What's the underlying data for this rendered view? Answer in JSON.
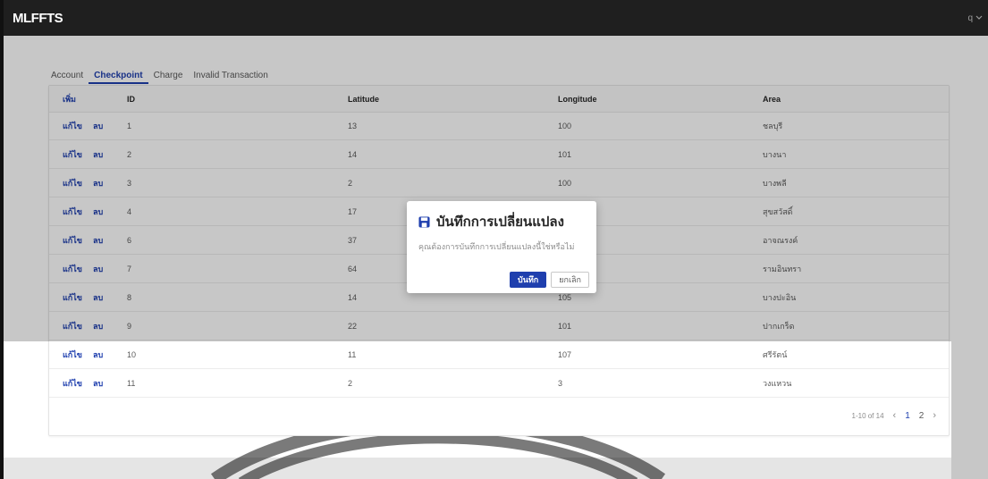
{
  "header": {
    "logo": "MLFFTS",
    "user_menu": "q"
  },
  "tabs": [
    {
      "label": "Account"
    },
    {
      "label": "Checkpoint",
      "active": true
    },
    {
      "label": "Charge"
    },
    {
      "label": "Invalid Transaction"
    }
  ],
  "table": {
    "add_label": "เพิ่ม",
    "columns": [
      "ID",
      "Latitude",
      "Longitude",
      "Area"
    ],
    "edit_label": "แก้ไข",
    "delete_label": "ลบ",
    "rows": [
      {
        "id": "1",
        "lat": "13",
        "lng": "100",
        "area": "ชลบุรี"
      },
      {
        "id": "2",
        "lat": "14",
        "lng": "101",
        "area": "บางนา"
      },
      {
        "id": "3",
        "lat": "2",
        "lng": "100",
        "area": "บางพลี"
      },
      {
        "id": "4",
        "lat": "17",
        "lng": "",
        "area": "สุขสวัสดิ์"
      },
      {
        "id": "6",
        "lat": "37",
        "lng": "",
        "area": "อาจณรงค์"
      },
      {
        "id": "7",
        "lat": "64",
        "lng": "",
        "area": "รามอินทรา"
      },
      {
        "id": "8",
        "lat": "14",
        "lng": "105",
        "area": "บางปะอิน"
      },
      {
        "id": "9",
        "lat": "22",
        "lng": "101",
        "area": "ปากเกร็ด"
      },
      {
        "id": "10",
        "lat": "11",
        "lng": "107",
        "area": "ศรีรัตน์"
      },
      {
        "id": "11",
        "lat": "2",
        "lng": "3",
        "area": "วงแหวน"
      }
    ]
  },
  "pagination": {
    "range": "1-10 of 14",
    "pages": [
      "1",
      "2"
    ],
    "current": "1"
  },
  "modal": {
    "icon": "save-icon",
    "title": "บันทึกการเปลี่ยนแปลง",
    "message": "คุณต้องการบันทึกการเปลี่ยนแปลงนี้ใช่หรือไม่",
    "confirm_label": "บันทึก",
    "cancel_label": "ยกเลิก"
  },
  "colors": {
    "primary": "#1f3fae",
    "topbar": "#1f1f1f"
  }
}
